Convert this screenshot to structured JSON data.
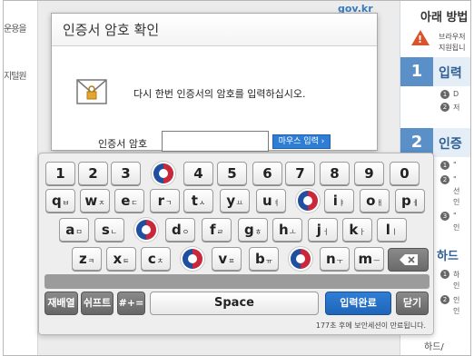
{
  "background": {
    "left_texts": [
      "운용을",
      "지털원"
    ],
    "banner_fragment": "gov.kr",
    "right_panel": {
      "header": "아래 방법",
      "warning_lines": [
        "브라우저",
        "지원됩니"
      ],
      "steps": [
        {
          "num": "1",
          "title": "입력",
          "lines": [
            "D",
            "저"
          ]
        },
        {
          "num": "2",
          "title": "인증",
          "lines": [
            "\"",
            "\"",
            "선",
            "인",
            "\"",
            "인"
          ]
        }
      ],
      "hard_section": "하드",
      "hard_lines": [
        "하",
        "인",
        "인",
        "인"
      ],
      "footer": "하드/"
    }
  },
  "dialog": {
    "title": "인증서 암호 확인",
    "message": "다시 한번 인증서의 암호를 입력하십시오.",
    "password_label": "인증서 암호",
    "password_value": "",
    "mouse_input_button": "마우스 입력 ›"
  },
  "keyboard": {
    "row_numbers": [
      "1",
      "2",
      "3",
      "4",
      "5",
      "6",
      "7",
      "8",
      "9",
      "0"
    ],
    "row1": [
      {
        "key": "q",
        "sub": "ㅂ"
      },
      {
        "key": "w",
        "sub": "ㅈ"
      },
      {
        "key": "e",
        "sub": "ㄷ"
      },
      {
        "key": "r",
        "sub": "ㄱ"
      },
      {
        "key": "t",
        "sub": "ㅅ"
      },
      {
        "key": "y",
        "sub": "ㅛ"
      },
      {
        "key": "u",
        "sub": "ㅕ"
      },
      {
        "key": "i",
        "sub": "ㅑ"
      },
      {
        "key": "o",
        "sub": "ㅐ"
      },
      {
        "key": "p",
        "sub": "ㅔ"
      }
    ],
    "row2": [
      {
        "key": "a",
        "sub": "ㅁ"
      },
      {
        "key": "s",
        "sub": "ㄴ"
      },
      {
        "key": "d",
        "sub": "ㅇ"
      },
      {
        "key": "f",
        "sub": "ㄹ"
      },
      {
        "key": "g",
        "sub": "ㅎ"
      },
      {
        "key": "h",
        "sub": "ㅗ"
      },
      {
        "key": "j",
        "sub": "ㅓ"
      },
      {
        "key": "k",
        "sub": "ㅏ"
      },
      {
        "key": "l",
        "sub": "ㅣ"
      }
    ],
    "row3": [
      {
        "key": "z",
        "sub": "ㅋ"
      },
      {
        "key": "x",
        "sub": "ㅌ"
      },
      {
        "key": "c",
        "sub": "ㅊ"
      },
      {
        "key": "v",
        "sub": "ㅍ"
      },
      {
        "key": "b",
        "sub": "ㅠ"
      },
      {
        "key": "n",
        "sub": "ㅜ"
      },
      {
        "key": "m",
        "sub": "ㅡ"
      }
    ],
    "backspace_icon": "backspace-icon",
    "relayout_label": "재배열",
    "shift_label": "쉬프트",
    "symbols_label": "#+=",
    "space_label": "Space",
    "enter_label": "입력완료",
    "close_label": "닫기",
    "session_notice": "177초 후에 보안세션이 만료됩니다."
  }
}
